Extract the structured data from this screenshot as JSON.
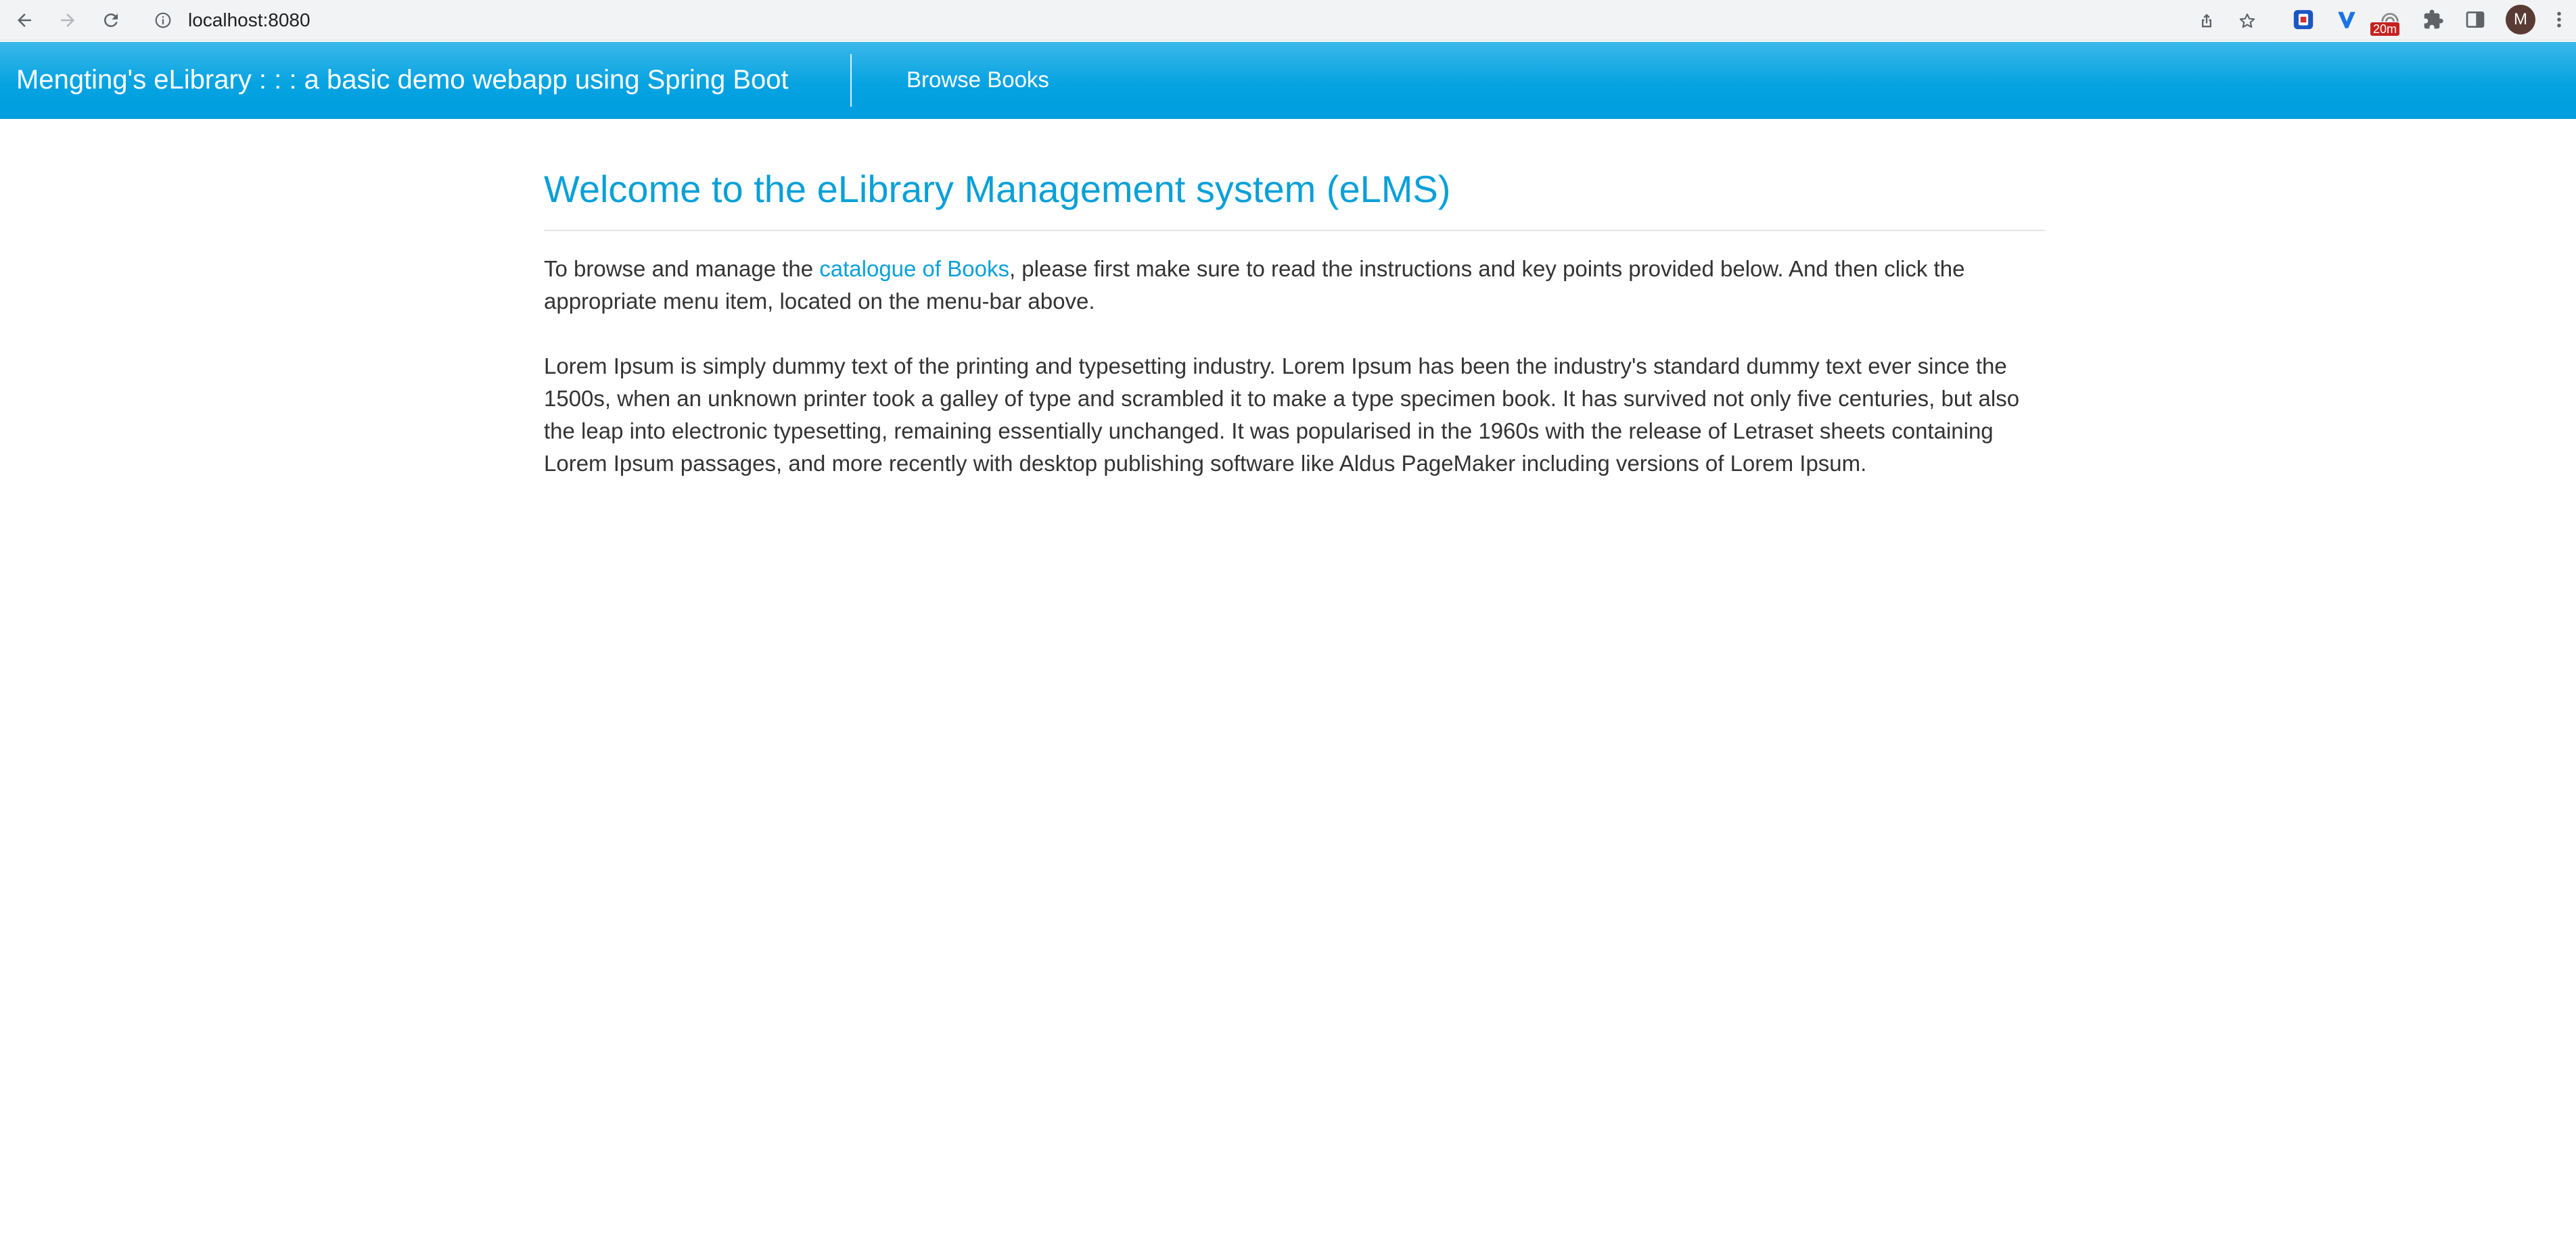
{
  "browser": {
    "url": "localhost:8080",
    "extension_badge": "20m",
    "avatar_letter": "M"
  },
  "navbar": {
    "brand": "Mengting's eLibrary : : : a basic demo webapp using Spring Boot",
    "browse_books": "Browse Books"
  },
  "main": {
    "title": "Welcome to the eLibrary Management system (eLMS)",
    "intro_before": "To browse and manage the ",
    "intro_link": "catalogue of Books",
    "intro_after": ", please first make sure to read the instructions and key points provided below. And then click the appropriate menu item, located on the menu-bar above.",
    "lorem": "Lorem Ipsum is simply dummy text of the printing and typesetting industry. Lorem Ipsum has been the industry's standard dummy text ever since the 1500s, when an unknown printer took a galley of type and scrambled it to make a type specimen book. It has survived not only five centuries, but also the leap into electronic typesetting, remaining essentially unchanged. It was popularised in the 1960s with the release of Letraset sheets containing Lorem Ipsum passages, and more recently with desktop publishing software like Aldus PageMaker including versions of Lorem Ipsum."
  },
  "colors": {
    "navbar_gradient_top": "#3bb8ea",
    "navbar_gradient_bottom": "#009de0",
    "title_color": "#0aa0d8",
    "link_color": "#0aa0d8",
    "body_text": "#333333"
  },
  "icons": {
    "back": "arrow-left-icon",
    "forward": "arrow-right-icon",
    "reload": "reload-icon",
    "site_info": "info-icon",
    "share": "share-icon",
    "bookmark": "star-icon",
    "extensions": "puzzle-icon",
    "side_panel": "side-panel-icon",
    "menu": "kebab-menu-icon"
  }
}
